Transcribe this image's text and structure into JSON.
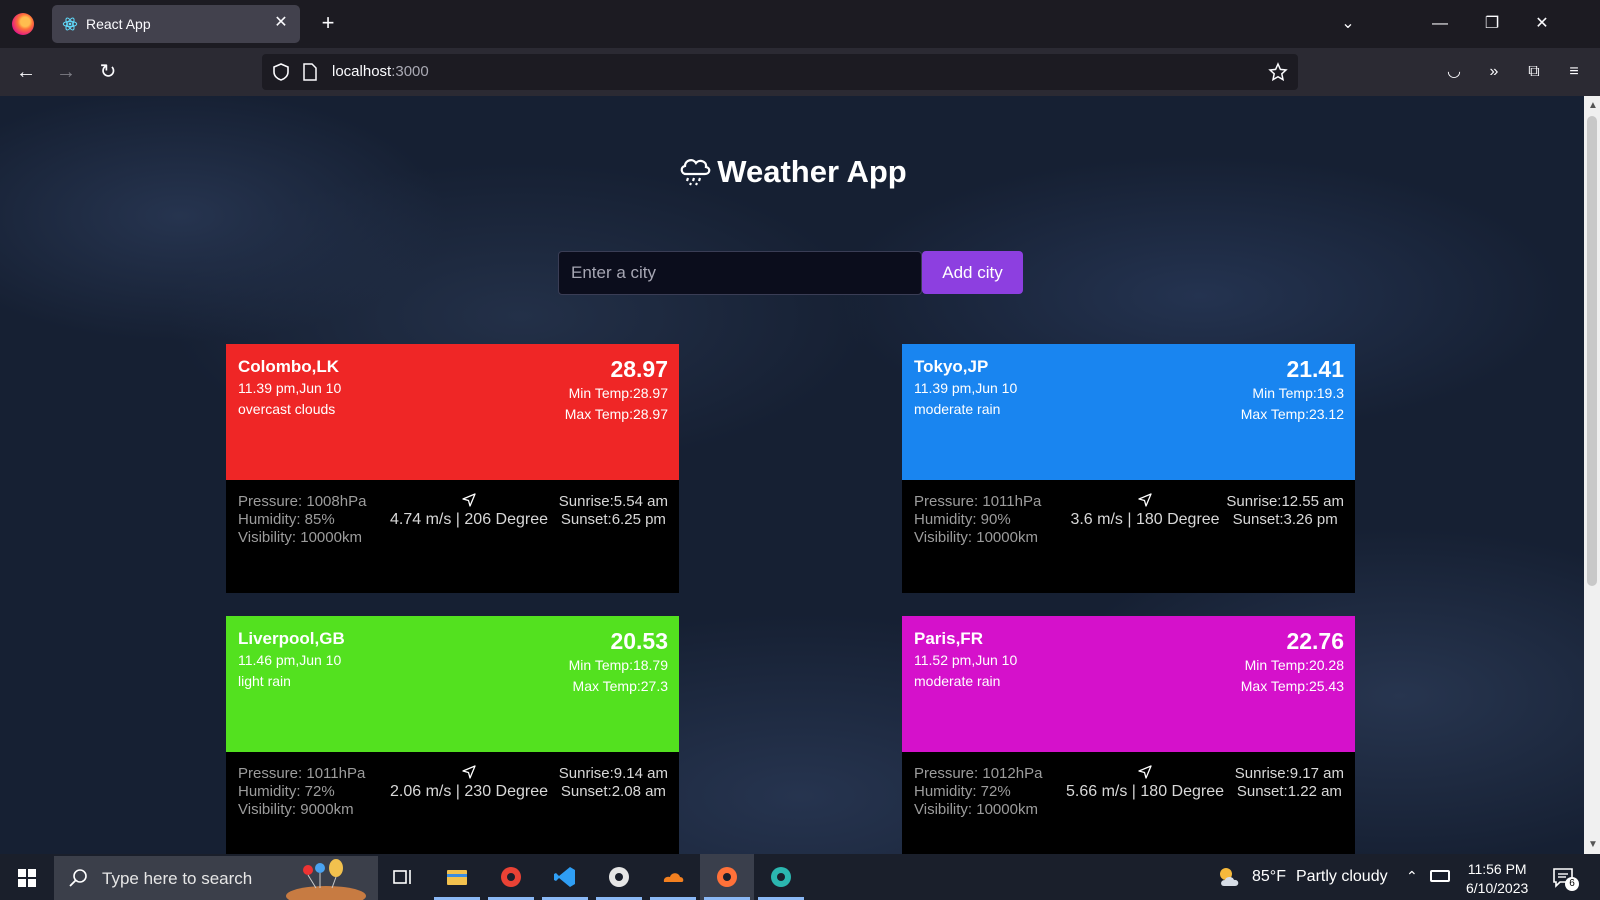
{
  "browser": {
    "tab_title": "React App",
    "url_host": "localhost",
    "url_port": ":3000"
  },
  "app": {
    "title": "Weather App",
    "input_placeholder": "Enter a city",
    "add_button": "Add city"
  },
  "cards": [
    {
      "color": "#ef2626",
      "name": "Colombo,LK",
      "time": "11.39 pm,Jun 10",
      "description": "overcast clouds",
      "temp": "28.97",
      "min_temp": "Min Temp:28.97",
      "max_temp": "Max Temp:28.97",
      "pressure": "Pressure: 1008hPa",
      "humidity": "Humidity: 85%",
      "visibility": "Visibility: 10000km",
      "wind": "4.74 m/s | 206 Degree",
      "sunrise": "Sunrise:5.54 am",
      "sunset": "Sunset:6.25 pm"
    },
    {
      "color": "#1985f0",
      "name": "Tokyo,JP",
      "time": "11.39 pm,Jun 10",
      "description": "moderate rain",
      "temp": "21.41",
      "min_temp": "Min Temp:19.3",
      "max_temp": "Max Temp:23.12",
      "pressure": "Pressure: 1011hPa",
      "humidity": "Humidity: 90%",
      "visibility": "Visibility: 10000km",
      "wind": "3.6 m/s | 180 Degree",
      "sunrise": "Sunrise:12.55 am",
      "sunset": "Sunset:3.26 pm"
    },
    {
      "color": "#53e11f",
      "name": "Liverpool,GB",
      "time": "11.46 pm,Jun 10",
      "description": "light rain",
      "temp": "20.53",
      "min_temp": "Min Temp:18.79",
      "max_temp": "Max Temp:27.3",
      "pressure": "Pressure: 1011hPa",
      "humidity": "Humidity: 72%",
      "visibility": "Visibility: 9000km",
      "wind": "2.06 m/s | 230 Degree",
      "sunrise": "Sunrise:9.14 am",
      "sunset": "Sunset:2.08 am"
    },
    {
      "color": "#d511cb",
      "name": "Paris,FR",
      "time": "11.52 pm,Jun 10",
      "description": "moderate rain",
      "temp": "22.76",
      "min_temp": "Min Temp:20.28",
      "max_temp": "Max Temp:25.43",
      "pressure": "Pressure: 1012hPa",
      "humidity": "Humidity: 72%",
      "visibility": "Visibility: 10000km",
      "wind": "5.66 m/s | 180 Degree",
      "sunrise": "Sunrise:9.17 am",
      "sunset": "Sunset:1.22 am"
    }
  ],
  "taskbar": {
    "search_placeholder": "Type here to search",
    "weather_temp": "85°F",
    "weather_text": "Partly cloudy",
    "time": "11:56 PM",
    "date": "6/10/2023",
    "notification_count": "6",
    "apps": [
      "task-view",
      "file-explorer",
      "chrome",
      "vscode",
      "obs",
      "cloudflare-warp",
      "firefox",
      "edge"
    ]
  }
}
